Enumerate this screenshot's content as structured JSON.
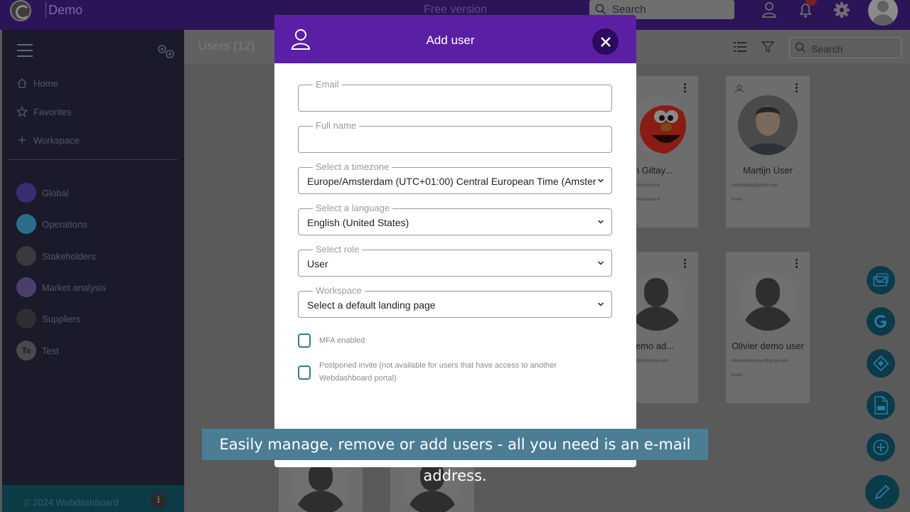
{
  "topbar": {
    "brand": "Demo",
    "free_version": "Free version",
    "search_placeholder": "Search"
  },
  "sidebar": {
    "nav": [
      {
        "label": "Home",
        "icon": "home-icon"
      },
      {
        "label": "Favorites",
        "icon": "star-icon"
      },
      {
        "label": "Workspace",
        "icon": "plus-icon"
      }
    ],
    "workspaces": [
      {
        "label": "Global",
        "icon": "globe-icon",
        "color": "#3b2d73"
      },
      {
        "label": "Operations",
        "icon": "operations-icon",
        "color": "#2a6f8a"
      },
      {
        "label": "Stakeholders",
        "icon": "stakeholders-icon",
        "color": "#3a3a3a"
      },
      {
        "label": "Market analysis",
        "icon": "market-analysis-icon",
        "color": "#4a3f6a"
      },
      {
        "label": "Suppliers",
        "icon": "suppliers-icon",
        "color": "#2f2f2f"
      },
      {
        "label": "Test",
        "initials": "Te"
      }
    ],
    "footer": "© 2024 Webdashboard",
    "info_glyph": "i"
  },
  "main": {
    "title": "Users (12)",
    "search_placeholder": "Search",
    "cards": [
      {
        "name": "Martijn Giltay...",
        "email": "m.giltay@insumma.nl",
        "email2": "m.giltay@insumma.nl"
      },
      {
        "name": "Martijn User",
        "email": "martijngiltay@gmail.com",
        "landing": "Home"
      },
      {
        "name": "...ier demo ad...",
        "email": "...demoadmin@gmail.com"
      },
      {
        "name": "Olivier demo user",
        "email": "oliviererdemouser@gmail.com",
        "landing": "Home"
      }
    ]
  },
  "modal": {
    "title": "Add user",
    "fields": {
      "email": {
        "label": "Email",
        "value": ""
      },
      "fullname": {
        "label": "Full name",
        "value": ""
      },
      "timezone": {
        "label": "Select a timezone",
        "value": "Europe/Amsterdam (UTC+01:00) Central European Time (Amsterdam)"
      },
      "language": {
        "label": "Select a language",
        "value": "English (United States)"
      },
      "role": {
        "label": "Select role",
        "value": "User"
      },
      "workspace": {
        "label": "Workspace",
        "value": "Select a default landing page"
      }
    },
    "mfa_label": "MFA enabled",
    "postponed_label": "Postponed invite (not available for users that have access to another Webdashboard portal)"
  },
  "caption": "Easily manage, remove or add users - all you need is an e-mail address.",
  "colors": {
    "topbar": "#2c1459",
    "modal_header": "#5b1fa6",
    "modal_close": "#2b0a60",
    "checkbox_border": "#2a7aa8",
    "caption_bg": "#4b7d95",
    "fab_bg": "#0b3b48"
  }
}
